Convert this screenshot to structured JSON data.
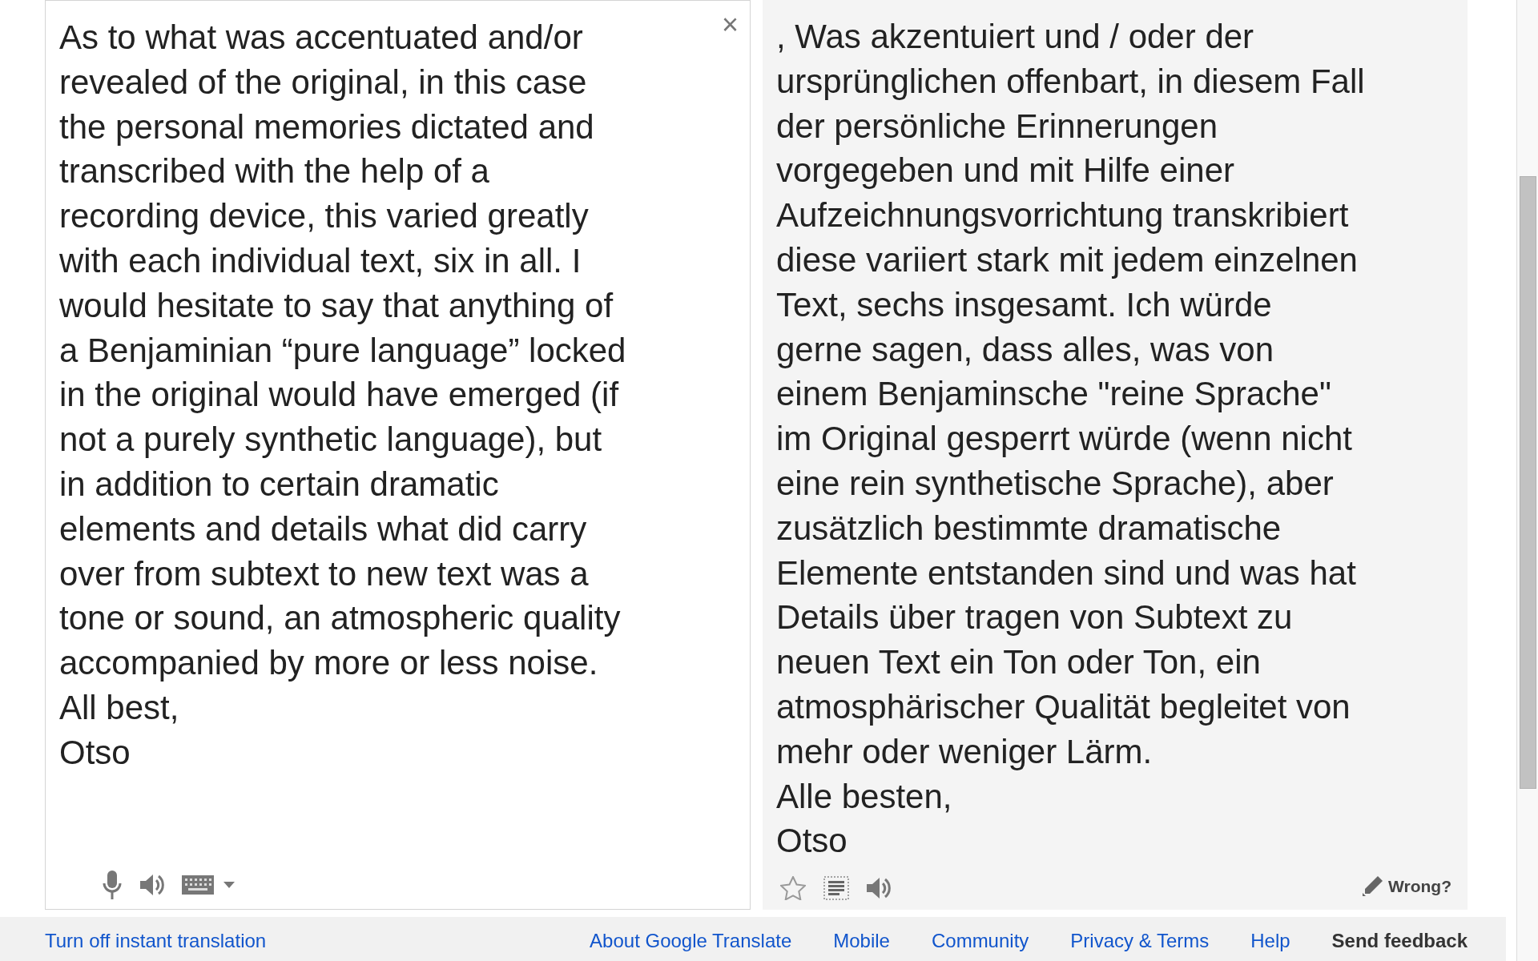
{
  "source": {
    "close": "×",
    "lines": [
      "As to what was accentuated and/or",
      "revealed of the original, in this case",
      "the personal memories dictated and",
      "transcribed with the help of a",
      "recording device, this varied greatly",
      "with each individual text, six in all. I",
      "would hesitate to say that anything of",
      "a Benjaminian “pure language” locked",
      "in the original would have emerged (if",
      "not a purely synthetic language), but",
      "in addition to certain dramatic",
      "elements and details what did carry",
      "over from subtext to new text was a",
      "tone or sound, an atmospheric quality",
      "accompanied by more or less noise.",
      "All best,",
      "Otso"
    ]
  },
  "target": {
    "lines": [
      ", Was akzentuiert und / oder der",
      "ursprünglichen offenbart, in diesem Fall",
      "der persönliche Erinnerungen",
      "vorgegeben und mit Hilfe einer",
      "Aufzeichnungsvorrichtung transkribiert",
      "diese variiert stark mit jedem einzelnen",
      "Text, sechs insgesamt. Ich würde",
      "gerne sagen, dass alles, was von",
      "einem Benjaminsche \"reine Sprache\"",
      "im Original gesperrt würde (wenn nicht",
      "eine rein synthetische Sprache), aber",
      "zusätzlich bestimmte dramatische",
      "Elemente entstanden sind und was hat",
      "Details über tragen von Subtext zu",
      "neuen Text ein Ton oder Ton, ein",
      "atmosphärischer Qualität begleitet von",
      "mehr oder weniger Lärm.",
      "Alle besten,",
      "Otso"
    ],
    "wrong": "Wrong?"
  },
  "footer": {
    "left": "Turn off instant translation",
    "links": [
      "About Google Translate",
      "Mobile",
      "Community",
      "Privacy & Terms",
      "Help"
    ],
    "feedback": "Send feedback"
  }
}
